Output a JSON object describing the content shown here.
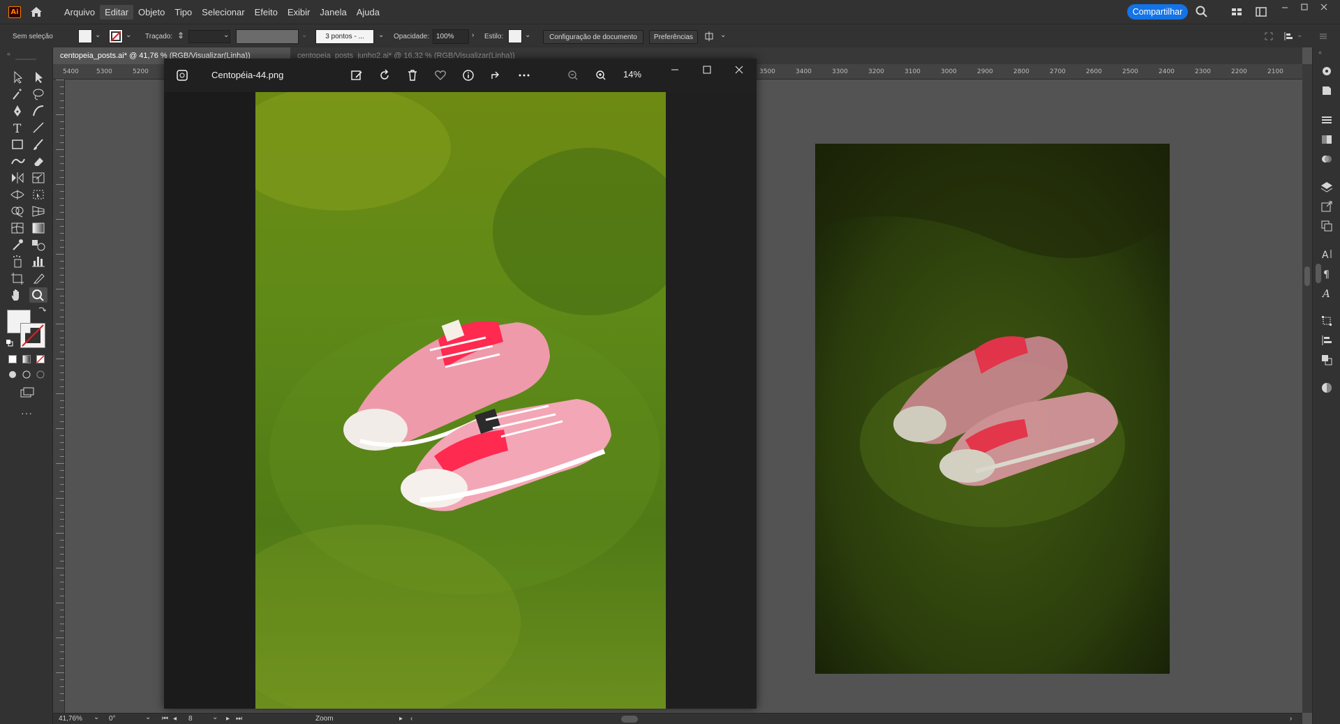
{
  "app": {
    "logo_text": "Ai",
    "menu": [
      "Arquivo",
      "Editar",
      "Objeto",
      "Tipo",
      "Selecionar",
      "Efeito",
      "Exibir",
      "Janela",
      "Ajuda"
    ],
    "share_label": "Compartilhar"
  },
  "control_bar": {
    "selection_label": "Sem seleção",
    "stroke_label": "Traçado:",
    "brush_value": "3 pontos - ...",
    "opacity_label": "Opacidade:",
    "opacity_value": "100%",
    "style_label": "Estilo:",
    "doc_setup_label": "Configuração de documento",
    "preferences_label": "Preferências"
  },
  "tabs": [
    {
      "label": "centopeia_posts.ai* @ 41,76 % (RGB/Visualizar(Linha))",
      "active": true
    },
    {
      "label": "centopeia_posts_junho2.ai* @ 16,32 % (RGB/Visualizar(Linha))",
      "active": false
    }
  ],
  "rulers": {
    "h_ticks_left": [
      "5400",
      "5300",
      "5200"
    ],
    "h_ticks_right": [
      "3500",
      "3400",
      "3300",
      "3200",
      "3100",
      "3000",
      "2900",
      "2800",
      "2700",
      "2600",
      "2500",
      "2400",
      "2300",
      "2200",
      "2100"
    ]
  },
  "viewer": {
    "title": "Centopéia-44.png",
    "zoom": "14%"
  },
  "status": {
    "zoom": "41,76%",
    "rotation": "0°",
    "artboard": "8",
    "tool": "Zoom"
  },
  "colors": {
    "accent": "#1473e6",
    "ui_dark": "#323232",
    "canvas": "#535353",
    "viewer_bg": "#1f1f1f"
  }
}
